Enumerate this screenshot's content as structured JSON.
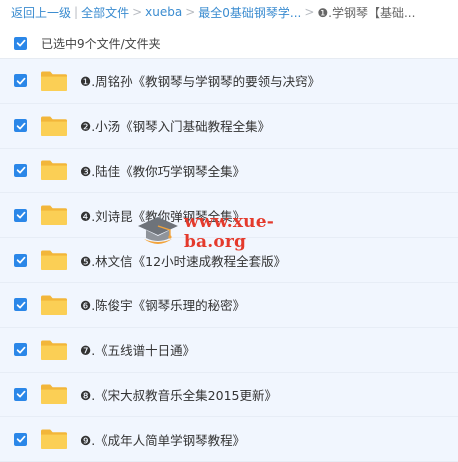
{
  "breadcrumb": {
    "back": "返回上一级",
    "sep": "|",
    "all_files": "全部文件",
    "arrow": ">",
    "xueba": "xueba",
    "course": "最全0基础钢琴学...",
    "current": "❶.学钢琴【基础..."
  },
  "selection": {
    "label": "已选中9个文件/文件夹"
  },
  "files": [
    {
      "name": "❶.周铭孙《教钢琴与学钢琴的要领与决窍》"
    },
    {
      "name": "❷.小汤《钢琴入门基础教程全集》"
    },
    {
      "name": "❸.陆佳《教你巧学钢琴全集》"
    },
    {
      "name": "❹.刘诗昆《教你弹钢琴全集》"
    },
    {
      "name": "❺.林文信《12小时速成教程全套版》"
    },
    {
      "name": "❻.陈俊宇《钢琴乐理的秘密》"
    },
    {
      "name": "❼.《五线谱十日通》"
    },
    {
      "name": "❽.《宋大叔教音乐全集2015更新》"
    },
    {
      "name": "❾.《成年人简单学钢琴教程》"
    }
  ],
  "watermark": {
    "text": "www.xue-ba.org"
  },
  "colors": {
    "link": "#3b8cd0",
    "checkbox": "#2b87e8",
    "folder": "#f9c94a",
    "row_selected": "#f1f6fe",
    "watermark": "#e43a2c"
  },
  "icons": {
    "checkbox": "checkbox-checked-icon",
    "folder": "folder-icon",
    "watermark_logo": "graduation-cap-icon"
  }
}
